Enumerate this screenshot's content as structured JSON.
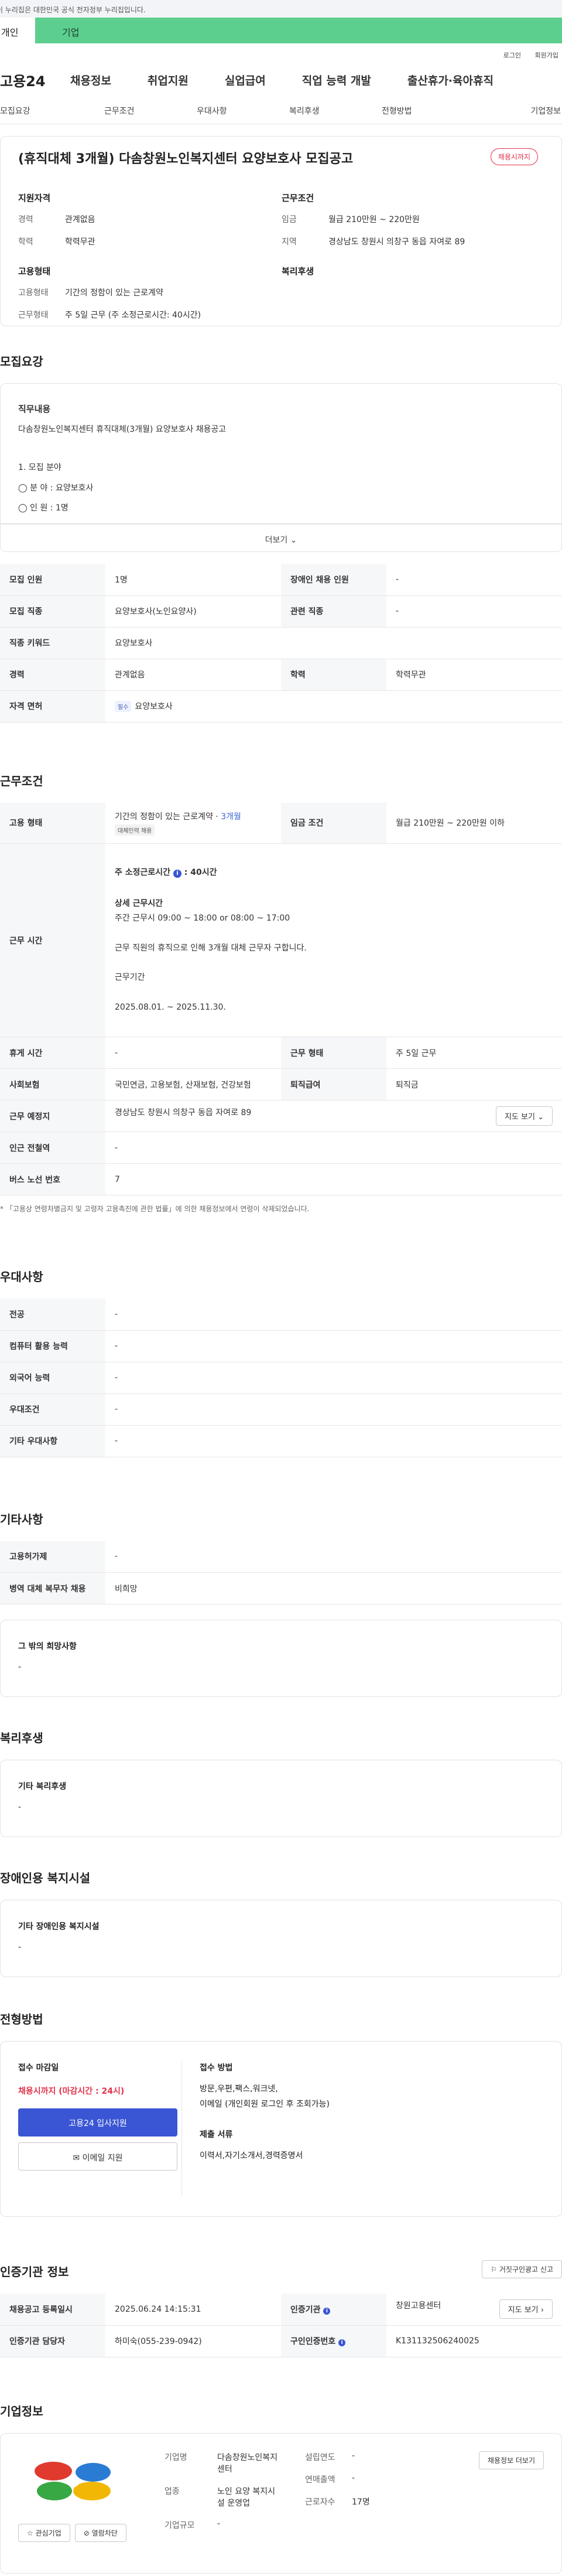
{
  "notice": "이 누리집은 대한민국 공식 전자정부 누리집입니다.",
  "top_tabs": [
    "개인",
    "기업"
  ],
  "util_links": [
    "로그인",
    "회원가입"
  ],
  "gnb": {
    "logo": "고용24",
    "menus": [
      "채용정보",
      "취업지원",
      "실업급여",
      "직업 능력 개발",
      "출산휴가·육아휴직"
    ]
  },
  "subnav": [
    "모집요강",
    "근무조건",
    "우대사항",
    "복리후생",
    "전형방법",
    "기업정보"
  ],
  "job": {
    "title": "(휴직대체 3개월) 다솜창원노인복지센터 요양보호사 모집공고",
    "badge": "채용시까지",
    "qual_title": "지원자격",
    "career_k": "경력",
    "career_v": "관계없음",
    "edu_k": "학력",
    "edu_v": "학력무관",
    "emp_title": "고용형태",
    "emptype_k": "고용형태",
    "emptype_v": "기간의 정함이 있는 근로계약",
    "work_k": "근무형태",
    "work_v": "주 5일 근무 (주 소정근로시간: 40시간)",
    "cond_title": "근무조건",
    "pay_k": "임금",
    "pay_v": "월급 210만원 ~ 220만원",
    "region_k": "지역",
    "region_v": "경상남도 창원시 의창구 동읍 자여로 89",
    "welfare_title": "복리후생"
  },
  "recruit": {
    "heading": "모집요강",
    "duty_sub": "직무내용",
    "duty_desc": "다솜창원노인복지센터 휴직대체(3개월) 요양보호사 채용공고",
    "line1": "1. 모집 분야",
    "line2": "◯ 분 야 : 요양보호사",
    "line3": "◯ 인 원 : 1명",
    "more": "더보기",
    "rows": {
      "count_k": "모집 인원",
      "count_v": "1명",
      "disabled_k": "장애인 채용 인원",
      "disabled_v": "-",
      "job_k": "모집 직종",
      "job_v": "요양보호사(노인요양사)",
      "related_k": "관련 직종",
      "related_v": "-",
      "keyword_k": "직종 키워드",
      "keyword_v": "요양보호사",
      "career_k": "경력",
      "career_v": "관계없음",
      "edu_k": "학력",
      "edu_v": "학력무관",
      "license_k": "자격 면허",
      "license_tag": "필수",
      "license_v": "요양보호사"
    }
  },
  "work": {
    "heading": "근무조건",
    "emptype_k": "고용 형태",
    "emptype_v": "기간의 정함이 있는 근로계약 · ",
    "emptype_v2": "3개월",
    "emptype_tag": "대체인력 채용",
    "pay_k": "임금 조건",
    "pay_v": "월급 210만원 ~ 220만원 이하",
    "hours_k": "근무 시간",
    "hours_main": "주 소정근로시간",
    "hours_main2": ": 40시간",
    "hours_detail_t": "상세 근무시간",
    "hours_detail": "주간 근무시 09:00 ~ 18:00 or 08:00 ~ 17:00",
    "hours_reason": "근무 직원의 휴직으로 인해 3개월 대체 근무자 구합니다.",
    "period_t": "근무기간",
    "period": "2025.08.01. ~ 2025.11.30.",
    "rest_k": "휴게 시간",
    "rest_v": "-",
    "worktype_k": "근무 형태",
    "worktype_v": "주 5일 근무",
    "insure_k": "사회보험",
    "insure_v": "국민연금, 고용보험, 산재보험, 건강보험",
    "retire_k": "퇴직급여",
    "retire_v": "퇴직금",
    "place_k": "근무 예정지",
    "place_v": "경상남도 창원시 의창구 동읍 자여로 89",
    "map_btn": "지도 보기",
    "subway_k": "인근 전철역",
    "subway_v": "-",
    "bus_k": "버스 노선 번호",
    "bus_v": "7",
    "note": "* 「고용상 연령차별금지 및 고령자 고용촉진에 관한 법률」에 의한 채용정보에서 연령이 삭제되었습니다."
  },
  "pref": {
    "heading": "우대사항",
    "major_k": "전공",
    "major_v": "-",
    "pc_k": "컴퓨터 활용 능력",
    "pc_v": "-",
    "lang_k": "외국어 능력",
    "lang_v": "-",
    "cond_k": "우대조건",
    "cond_v": "-",
    "etc_k": "기타 우대사항",
    "etc_v": "-"
  },
  "etc": {
    "heading": "기타사항",
    "permit_k": "고용허가제",
    "permit_v": "-",
    "army_k": "병역 대체 복무자 채용",
    "army_v": "비희망",
    "other_t": "그 밖의 희망사항",
    "other_v": "-"
  },
  "welfare": {
    "heading": "복리후생",
    "etc_t": "기타 복리후생",
    "etc_v": "-"
  },
  "disabled": {
    "heading": "장애인용 복지시설",
    "etc_t": "기타 장애인용 복지시설",
    "etc_v": "-"
  },
  "apply": {
    "heading": "전형방법",
    "deadline_t": "접수 마감일",
    "deadline_v": "채용시까지 (마감시간 : 24시)",
    "apply_btn": "고용24 입사지원",
    "email_btn": "이메일 지원",
    "method_t": "접수 방법",
    "method_v1": "방문,우편,팩스,워크넷,",
    "method_v2": "이메일 (개인회원 로그인 후 조회가능)",
    "docs_t": "제출 서류",
    "docs_v": "이력서,자기소개서,경력증명서"
  },
  "agency": {
    "heading": "인증기관 정보",
    "report_btn": "거짓구인광고 신고",
    "reg_k": "채용공고 등록일시",
    "reg_v": "2025.06.24 14:15:31",
    "auth_k": "인증기관",
    "auth_v": "창원고용센터",
    "map_btn": "지도 보기",
    "manager_k": "인증기관 담당자",
    "manager_v": "하미숙(055-239-0942)",
    "no_k": "구인인증번호",
    "no_v": "K131132506240025"
  },
  "corp": {
    "heading": "기업정보",
    "fav_btn": "관심기업",
    "block_btn": "열람차단",
    "name_k": "기업명",
    "name_v": "다솜창원노인복지센터",
    "industry_k": "업종",
    "industry_v": "노인 요양 복지시설 운영업",
    "scale_k": "기업규모",
    "scale_v": "-",
    "year_k": "설립연도",
    "year_v": "-",
    "sales_k": "연매출액",
    "sales_v": "-",
    "workers_k": "근로자수",
    "workers_v": "17명",
    "other_btn": "채용정보 더보기"
  }
}
